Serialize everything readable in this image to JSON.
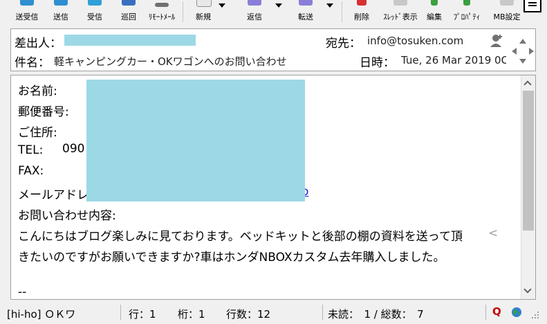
{
  "toolbar": {
    "buttons": [
      {
        "label": "送受信",
        "icon": "send-receive-icon"
      },
      {
        "label": "送信",
        "icon": "send-icon"
      },
      {
        "label": "受信",
        "icon": "receive-icon"
      },
      {
        "label": "巡回",
        "icon": "patrol-icon"
      },
      {
        "label": "ﾘﾓｰﾄﾒｰﾙ",
        "icon": "remote-mail-icon"
      },
      {
        "label": "新規",
        "icon": "new-mail-icon"
      },
      {
        "label": "返信",
        "icon": "reply-icon"
      },
      {
        "label": "転送",
        "icon": "forward-icon"
      },
      {
        "label": "削除",
        "icon": "delete-icon"
      },
      {
        "label": "ｽﾚｯﾄﾞ表示",
        "icon": "thread-view-icon"
      },
      {
        "label": "編集",
        "icon": "edit-icon"
      },
      {
        "label": "ﾌﾟﾛﾊﾟﾃｨ",
        "icon": "properties-icon"
      },
      {
        "label": "MB設定",
        "icon": "mailbox-settings-icon"
      }
    ]
  },
  "header": {
    "from_label": "差出人：",
    "to_label": "宛先：",
    "to_value": "info@tosuken.com",
    "subject_label": "件名：",
    "subject_value": "軽キャンピングカー・OKワゴンへのお問い合わせ",
    "date_label": "日時：",
    "date_value": "Tue, 26 Mar 2019 0C"
  },
  "body": {
    "lines": [
      "お名前:",
      "郵便番号:",
      "ご住所:",
      "TEL:",
      "FAX:",
      "メールアドレ",
      "お問い合わせ内容:",
      "こんにちはブログ楽しみに見ております。ベッドキットと後部の棚の資料を送って頂",
      "きたいのですがお願いできますか?車はホンダNBOXカスタム去年購入しました。",
      "--"
    ],
    "tel_partial": "090",
    "email_tail": "o",
    "wrap_mark": "<"
  },
  "status": {
    "account": "[hi-ho] ＯＫワ",
    "row": "行：1",
    "col": "桁：1",
    "line_count": "行数：12",
    "unread": "未読：　1 / 総数：　7",
    "q_badge": "Q"
  }
}
